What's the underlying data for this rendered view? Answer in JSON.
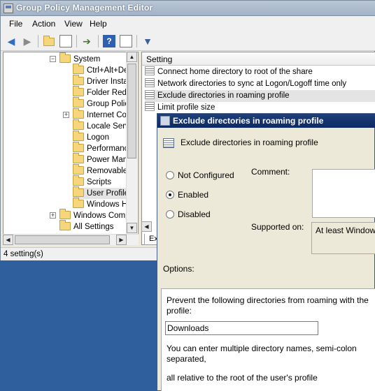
{
  "window": {
    "title": "Group Policy Management Editor"
  },
  "menubar": {
    "items": [
      "File",
      "Action",
      "View",
      "Help"
    ]
  },
  "toolbar": {
    "buttons": [
      "back-arrow-icon",
      "forward-arrow-icon",
      "up-folder-icon",
      "show-hide-tree-icon",
      "export-list-icon",
      "help-icon",
      "properties-icon",
      "filter-icon"
    ]
  },
  "tree": {
    "items": [
      {
        "label": "System",
        "expander": "−"
      },
      {
        "label": "Ctrl+Alt+De"
      },
      {
        "label": "Driver Insta"
      },
      {
        "label": "Folder Redi"
      },
      {
        "label": "Group Policy"
      },
      {
        "label": "Internet Co",
        "expander": "+"
      },
      {
        "label": "Locale Serv"
      },
      {
        "label": "Logon"
      },
      {
        "label": "Performanc"
      },
      {
        "label": "Power Mana"
      },
      {
        "label": "Removable"
      },
      {
        "label": "Scripts"
      },
      {
        "label": "User Profile"
      },
      {
        "label": "Windows Ho"
      },
      {
        "label": "Windows Compo",
        "expander": "+"
      },
      {
        "label": "All Settings"
      }
    ]
  },
  "list": {
    "column_header": "Setting",
    "rows": [
      "Connect home directory to root of the share",
      "Network directories to sync at Logon/Logoff time only",
      "Exclude directories in roaming profile",
      "Limit profile size"
    ],
    "selected_index": 2,
    "tab_label": "Ex"
  },
  "status": {
    "text": "4 setting(s)"
  },
  "dialog": {
    "title": "Exclude directories in roaming profile",
    "header_label": "Exclude directories in roaming profile",
    "radio_options": [
      "Not Configured",
      "Enabled",
      "Disabled"
    ],
    "selected_radio": "Enabled",
    "comment_label": "Comment:",
    "supported_label": "Supported on:",
    "supported_value": "At least Windows",
    "options_label": "Options:",
    "options": {
      "prevent_text": "Prevent the following directories from roaming with the profile:",
      "dirs_value": "Downloads",
      "hint_line1": "You can enter multiple directory names, semi-colon separated,",
      "hint_line2": "all relative to the root of the user's profile"
    }
  }
}
